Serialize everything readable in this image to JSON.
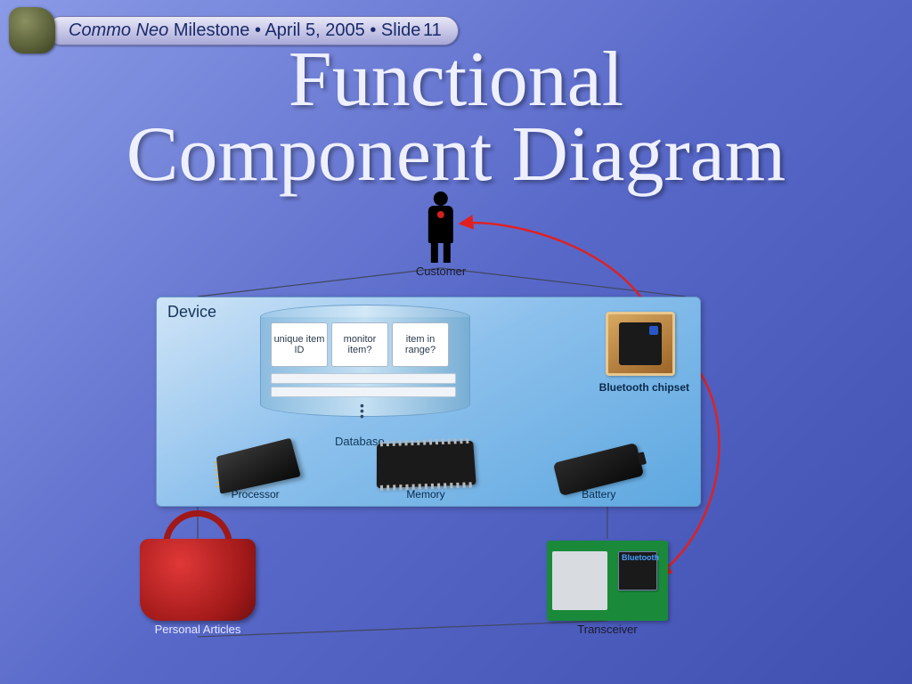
{
  "header": {
    "project": "Commo Neo",
    "milestone_word": "Milestone",
    "sep": "•",
    "date": "April 5, 2005",
    "slide_word": "Slide",
    "slide_num": "11"
  },
  "title_line1": "Functional",
  "title_line2": "Component Diagram",
  "nodes": {
    "customer": "Customer",
    "device": "Device",
    "database": "Database",
    "bluetooth": "Bluetooth chipset",
    "processor": "Processor",
    "memory": "Memory",
    "battery": "Battery",
    "articles": "Personal Articles",
    "transceiver": "Transceiver"
  },
  "db_fields": {
    "f1": "unique item ID",
    "f2": "monitor item?",
    "f3": "item in range?"
  },
  "colors": {
    "arrow": "#e02020",
    "wire": "#404860"
  }
}
